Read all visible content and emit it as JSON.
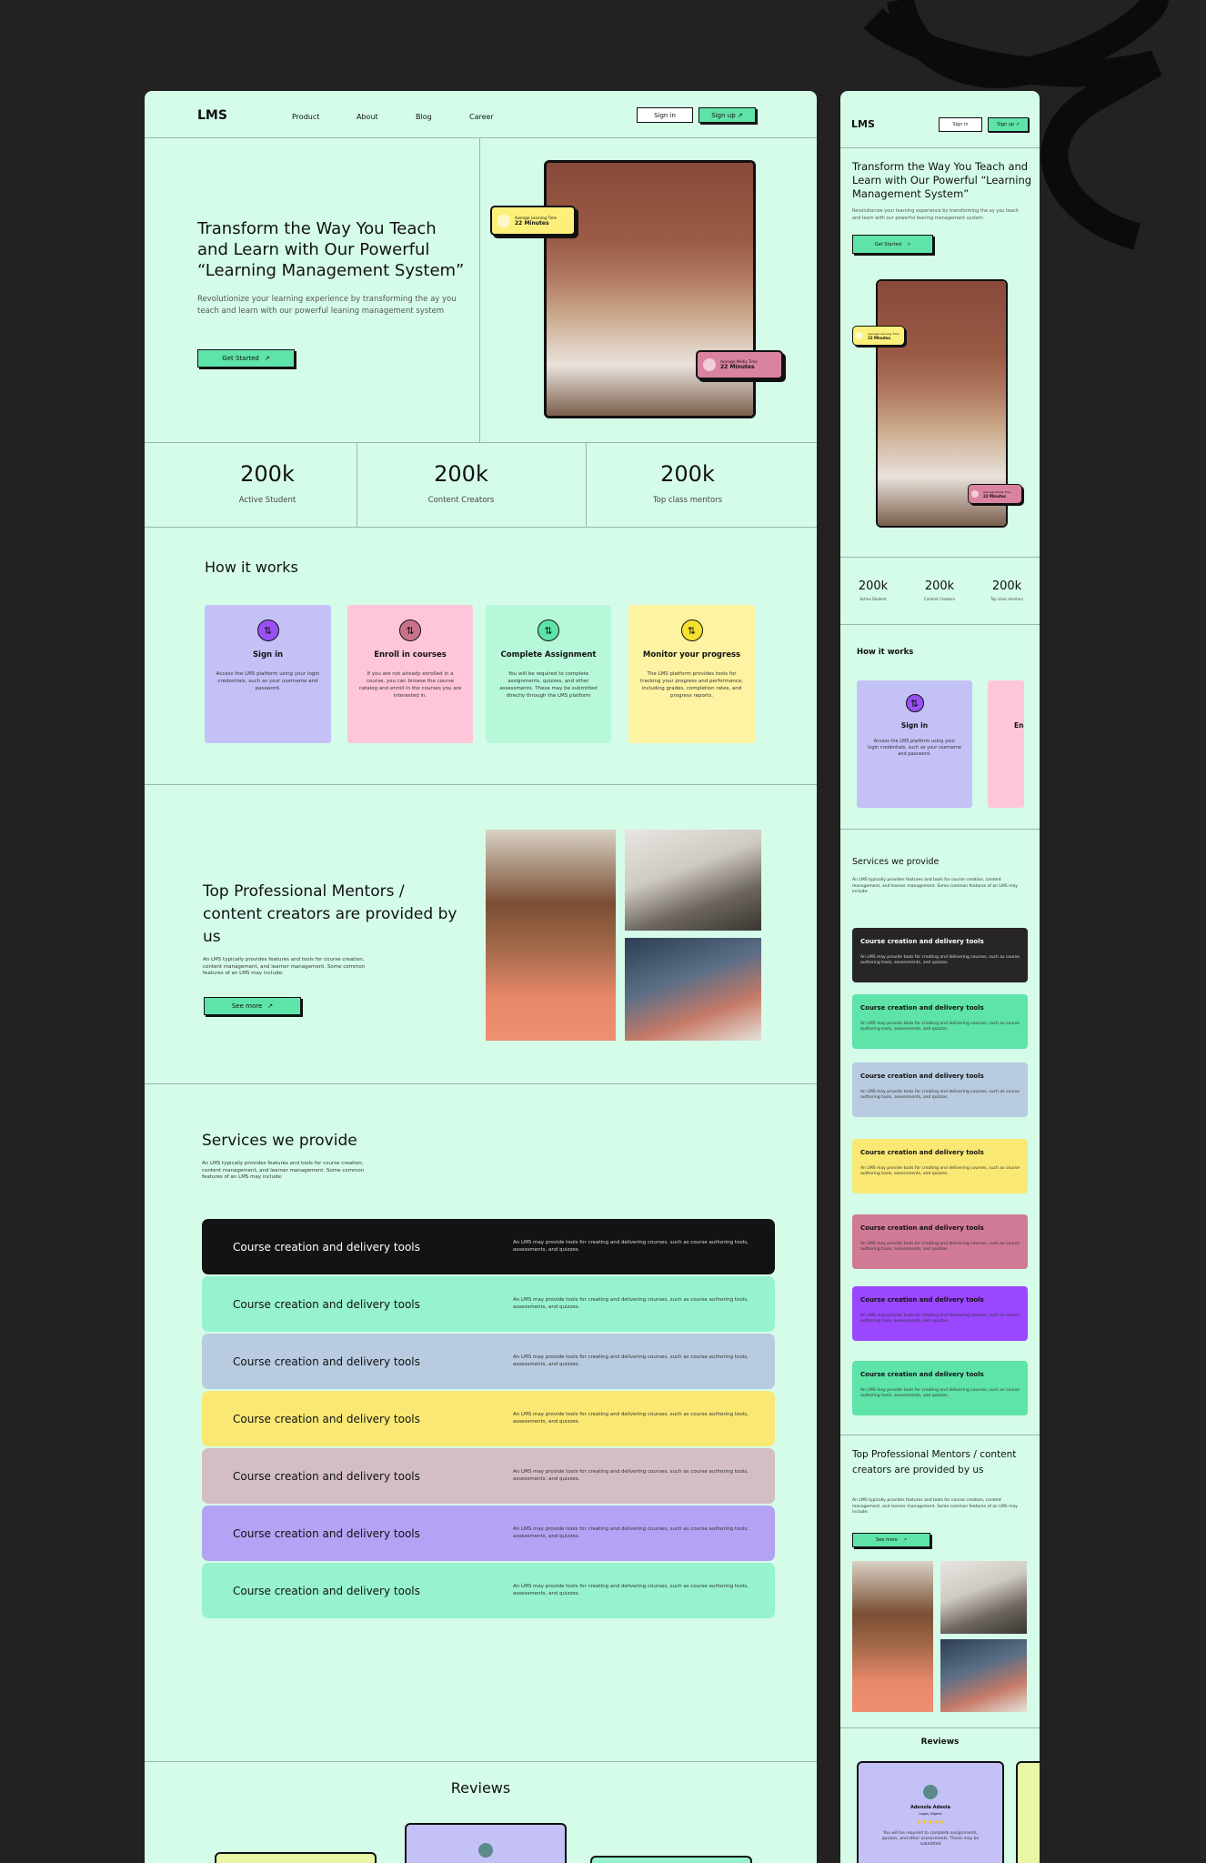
{
  "colors": {
    "bg": "#232121",
    "mint": "#d5fce9",
    "green": "#5ee3a8",
    "purple_card": "#c4c1f7",
    "pink_card": "#ffc6d9",
    "mint_card": "#b8f8da",
    "yellow_card": "#fdf3a2"
  },
  "nav": {
    "logo": "LMS",
    "links": [
      "Product",
      "About",
      "Blog",
      "Career"
    ],
    "signin": "Sign in",
    "signup": "Sign up ↗"
  },
  "hero": {
    "title": "Transform the Way You Teach and Learn with Our Powerful “Learning Management System”",
    "subtitle": "Revolutionize your learning experience by transforming the ay you teach and learn  with our powerful leaning management system",
    "cta": "Get Started",
    "badge_left": {
      "label": "Average Learning Time",
      "value": "22 Minutes"
    },
    "badge_right": {
      "label": "Average Media Time",
      "value": "22 Minutes"
    }
  },
  "stats": [
    {
      "num": "200k",
      "label": "Active Student"
    },
    {
      "num": "200k",
      "label": "Content Creators"
    },
    {
      "num": "200k",
      "label": "Top class mentors"
    }
  ],
  "how": {
    "title": "How it works",
    "cards": [
      {
        "title": "Sign in",
        "desc": "Access the LMS platform using your login credentials, such as your username and password.",
        "icon": "path-icon"
      },
      {
        "title": "Enroll in courses",
        "desc": "If you are not already enrolled in a course, you can browse the course catalog and enroll in the courses you are interested in.",
        "icon": "path-icon"
      },
      {
        "title": "Complete Assignment",
        "desc": "You will be required to complete assignments, quizzes, and other assessments. These may be submitted directly through the LMS platform",
        "icon": "path-icon"
      },
      {
        "title": "Monitor your progress",
        "desc": "The LMS platform provides tools for tracking your progress and performance, including grades, completion rates, and progress reports.",
        "icon": "path-icon"
      }
    ]
  },
  "mentors": {
    "title": "Top Professional Mentors / content creators are provided by us",
    "subtitle": "An LMS typically provides features and tools for course creation, content management, and learner management. Some common features of an LMS may include:",
    "cta": "See more"
  },
  "services": {
    "title": "Services we provide",
    "subtitle": "An LMS typically provides features and tools for course creation, content management, and learner management. Some common features of an LMS may include:",
    "items": [
      {
        "title": "Course creation and delivery tools",
        "desc": "An LMS may provide tools for creating and delivering courses, such as course authoring tools, assessments, and quizzes.",
        "color": "#131313",
        "text": "#ffffff"
      },
      {
        "title": "Course creation and delivery tools",
        "desc": "An LMS may provide tools for creating and delivering courses, such as course authoring tools, assessments, and quizzes.",
        "color": "#96f2cf",
        "text": "#111111"
      },
      {
        "title": "Course creation and delivery tools",
        "desc": "An LMS may provide tools for creating and delivering courses, such as course authoring tools, assessments, and quizzes.",
        "color": "#b8cbe0",
        "text": "#111111"
      },
      {
        "title": "Course creation and delivery tools",
        "desc": "An LMS may provide tools for creating and delivering courses, such as course authoring tools, assessments, and quizzes.",
        "color": "#f9e874",
        "text": "#111111"
      },
      {
        "title": "Course creation and delivery tools",
        "desc": "An LMS may provide tools for creating and delivering courses, such as course authoring tools, assessments, and quizzes.",
        "color": "#d3bec4",
        "text": "#111111"
      },
      {
        "title": "Course creation and delivery tools",
        "desc": "An LMS may provide tools for creating and delivering courses, such as course authoring tools, assessments, and quizzes.",
        "color": "#b4a2f4",
        "text": "#111111"
      },
      {
        "title": "Course creation and delivery tools",
        "desc": "An LMS may provide tools for creating and delivering courses, such as course authoring tools, assessments, and quizzes.",
        "color": "#96f2cf",
        "text": "#111111"
      }
    ],
    "mobile_colors": [
      "#282526",
      "#5ee3a8",
      "#b8cbe0",
      "#f9e874",
      "#d07a95",
      "#9a47ff",
      "#5ee3a8"
    ]
  },
  "reviews": {
    "title": "Reviews",
    "mobile_card": {
      "name": "Adenola Adeola",
      "role": "Lagos, Nigeria",
      "stars": "★★★★★",
      "text": "You will be required to complete assignments, quizzes, and other assessments. These may be submitted"
    }
  }
}
